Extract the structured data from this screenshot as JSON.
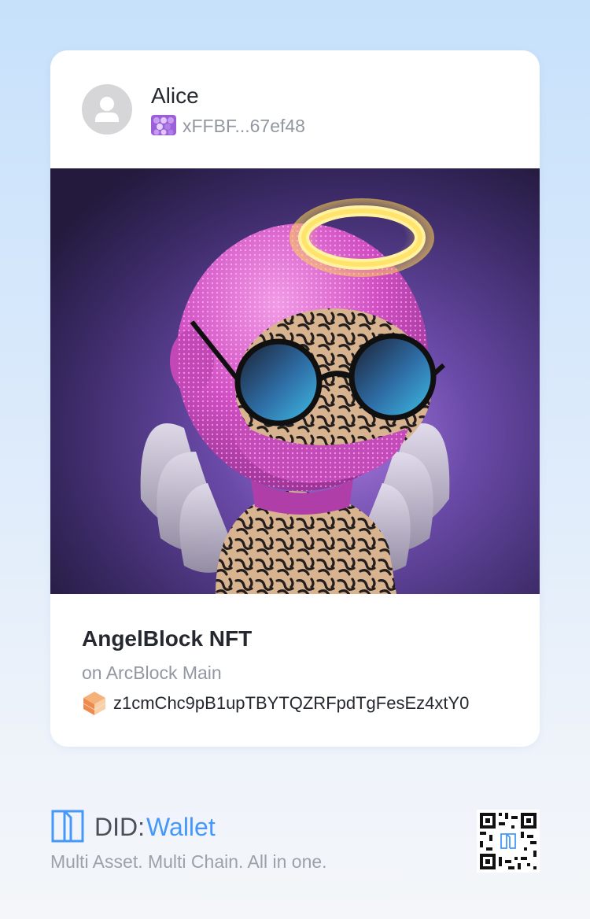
{
  "owner": {
    "name": "Alice",
    "address": "xFFBF...67ef48",
    "avatar_icon": "user-avatar-icon",
    "address_icon": "did-address-icon"
  },
  "nft": {
    "image_alt": "AngelBlock NFT artwork",
    "name": "AngelBlock NFT",
    "chain": "on ArcBlock Main",
    "asset_address": "z1cmChc9pB1upTBYTQZRFpdTgFesEz4xtY0",
    "asset_icon": "cube-icon"
  },
  "brand": {
    "did": "DID:",
    "wallet": "Wallet",
    "tagline": "Multi Asset. Multi Chain. All in one.",
    "logo_icon": "did-wallet-logo-icon",
    "qr_icon": "qr-code-icon"
  },
  "colors": {
    "accent": "#4598fa",
    "text_primary": "#25292f",
    "text_secondary": "#9397a1"
  }
}
